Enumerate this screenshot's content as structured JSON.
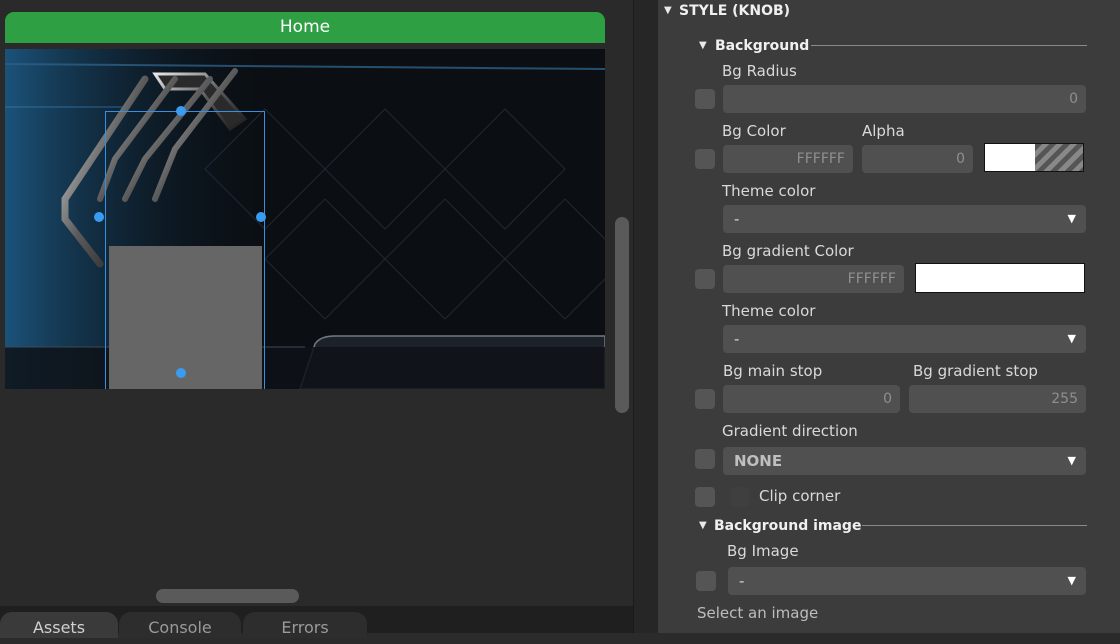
{
  "canvas": {
    "title": "Home"
  },
  "bottom_tabs": [
    "Assets",
    "Console",
    "Errors"
  ],
  "panel": {
    "style_header": "STYLE (KNOB)",
    "background": {
      "title": "Background",
      "bg_radius": {
        "label": "Bg Radius",
        "value": "0"
      },
      "bg_color": {
        "label": "Bg Color",
        "value": "FFFFFF",
        "alpha_label": "Alpha",
        "alpha_value": "0",
        "swatch": "#ffffff"
      },
      "theme_color_1": {
        "label": "Theme color",
        "value": "-"
      },
      "bg_gradient_color": {
        "label": "Bg gradient Color",
        "value": "FFFFFF",
        "swatch": "#ffffff"
      },
      "theme_color_2": {
        "label": "Theme color",
        "value": "-"
      },
      "bg_main_stop": {
        "label": "Bg main stop",
        "value": "0"
      },
      "bg_gradient_stop": {
        "label": "Bg gradient stop",
        "value": "255"
      },
      "gradient_direction": {
        "label": "Gradient direction",
        "value": "NONE"
      },
      "clip_corner": {
        "label": "Clip corner"
      }
    },
    "background_image": {
      "title": "Background image",
      "bg_image": {
        "label": "Bg Image",
        "value": "-"
      },
      "hint": "Select an image"
    }
  },
  "colors": {
    "home_bar": "#2ea043",
    "selection": "#3a8fe0",
    "panel_bg": "#3c3c3c"
  }
}
